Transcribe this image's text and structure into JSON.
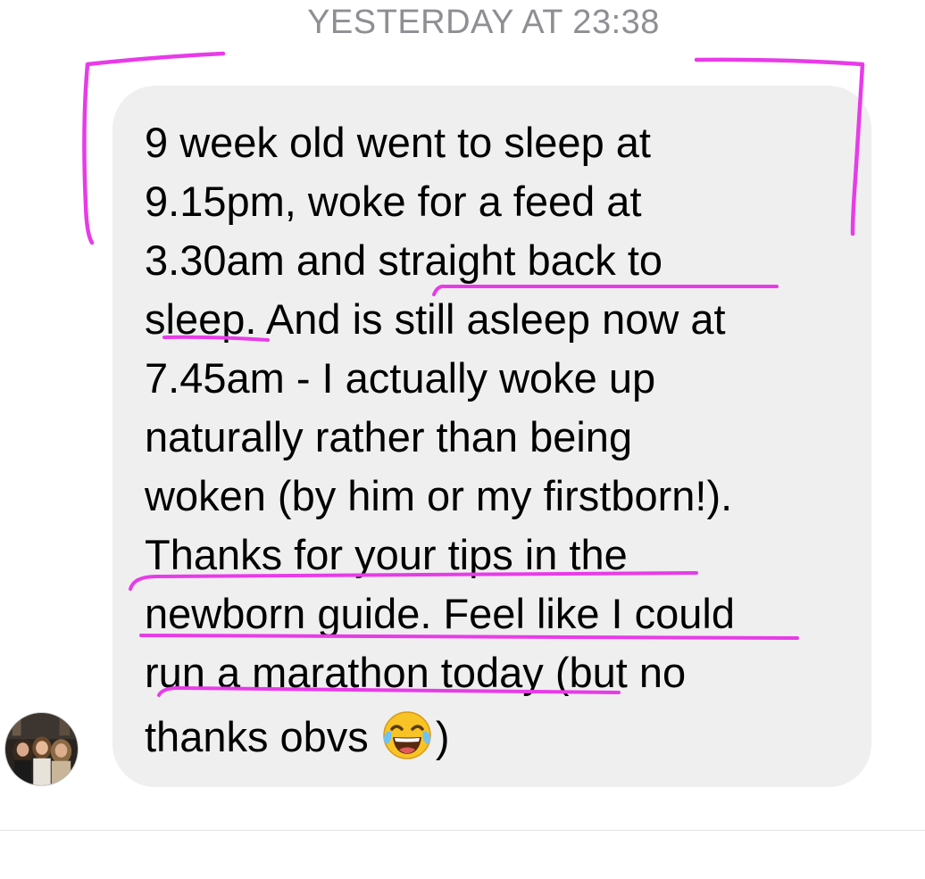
{
  "timestamp": "YESTERDAY AT 23:38",
  "message": {
    "lines": [
      "9 week old went to sleep at",
      "9.15pm, woke for a feed at",
      "3.30am and straight back to",
      "sleep. And is still asleep now at",
      "7.45am - I actually woke up",
      "naturally rather than being",
      "woken (by him or my firstborn!).",
      "Thanks for your tips in the",
      "newborn guide. Feel like I could",
      "run a marathon today (but no"
    ],
    "last_line_before_emoji": "thanks obvs ",
    "last_line_after_emoji": ")",
    "emoji_icon": "tears-of-joy-emoji"
  },
  "sender": {
    "avatar_icon": "profile-photo-avatar"
  },
  "colors": {
    "bubble_background": "#efefef",
    "timestamp_text": "#8e8e93",
    "annotation_marker": "#e83be8"
  }
}
